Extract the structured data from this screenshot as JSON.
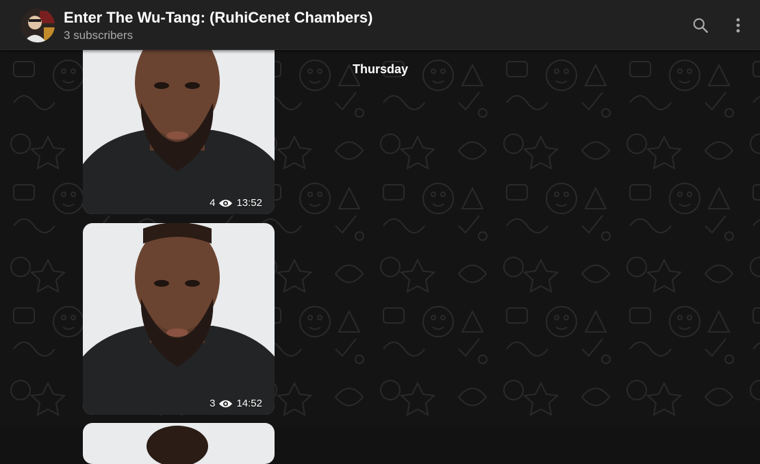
{
  "channel": {
    "title": "Enter The Wu-Tang: (RuhiCenet Chambers)",
    "subscribers": "3 subscribers"
  },
  "header_icons": {
    "search": "search-icon",
    "menu": "more-vertical-icon"
  },
  "date_separator": "Thursday",
  "posts": [
    {
      "views": "4",
      "time": "13:52"
    },
    {
      "views": "3",
      "time": "14:52"
    }
  ],
  "colors": {
    "header_bg": "#212121",
    "chat_bg": "#141414",
    "subtitle": "#aaaaaa"
  }
}
